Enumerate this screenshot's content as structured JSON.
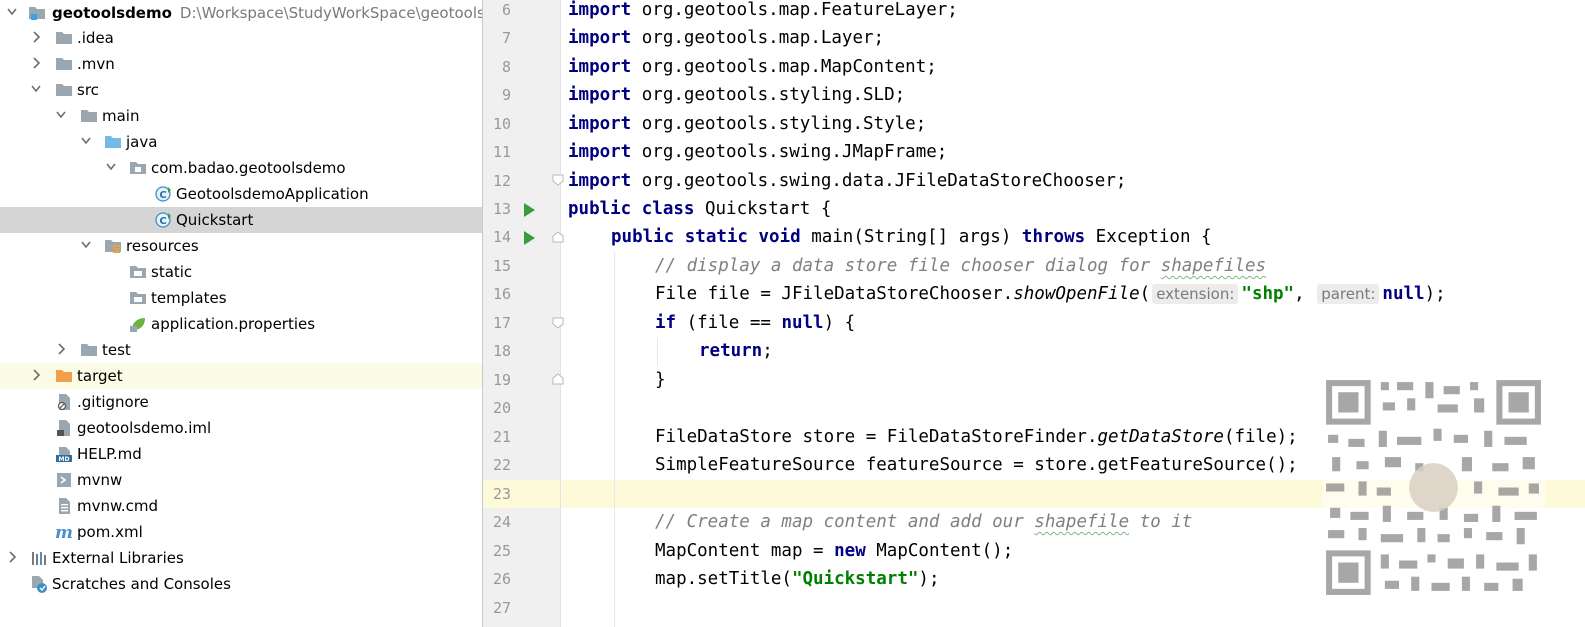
{
  "project": {
    "name": "geotoolsdemo",
    "path": "D:\\Workspace\\StudyWorkSpace\\geotoolsde",
    "items": {
      "idea": ".idea",
      "mvn": ".mvn",
      "src": "src",
      "main": "main",
      "java": "java",
      "package": "com.badao.geotoolsdemo",
      "app_class": "GeotoolsdemoApplication",
      "quickstart": "Quickstart",
      "resources": "resources",
      "static": "static",
      "templates": "templates",
      "app_props": "application.properties",
      "test": "test",
      "target": "target",
      "gitignore": ".gitignore",
      "iml": "geotoolsdemo.iml",
      "help": "HELP.md",
      "mvnw": "mvnw",
      "mvnw_cmd": "mvnw.cmd",
      "pom": "pom.xml",
      "ext_libs": "External Libraries",
      "scratches": "Scratches and Consoles"
    },
    "icon_badges": {
      "md": "MD",
      "maven": "m"
    }
  },
  "editor": {
    "line_numbers": [
      "6",
      "7",
      "8",
      "9",
      "10",
      "11",
      "12",
      "13",
      "14",
      "15",
      "16",
      "17",
      "18",
      "19",
      "20",
      "21",
      "22",
      "23",
      "24",
      "25",
      "26",
      "27"
    ],
    "current_line": "23",
    "tokens": {
      "import": "import",
      "l6": " org.geotools.map.FeatureLayer;",
      "l7": " org.geotools.map.Layer;",
      "l8": " org.geotools.map.MapContent;",
      "l9": " org.geotools.styling.SLD;",
      "l10": " org.geotools.styling.Style;",
      "l11": " org.geotools.swing.JMapFrame;",
      "l12": " org.geotools.swing.data.JFileDataStoreChooser;",
      "l13_kw": "public class",
      "l13_rest": " Quickstart {",
      "l14_kw1": "public static void",
      "l14_mid": " main(String[] args) ",
      "l14_kw2": "throws",
      "l14_rest": " Exception {",
      "l15_cmt_a": "// display a data store file chooser dialog for ",
      "l15_cmt_b": "shapefiles",
      "l16_a": "File file = JFileDataStoreChooser.",
      "l16_method": "showOpenFile",
      "l16_paren": "(",
      "l16_hint1": "extension:",
      "l16_str": "\"shp\"",
      "l16_comma": ",",
      "l16_hint2": "parent:",
      "l16_null": "null",
      "l16_end": ");",
      "l17_if": "if",
      "l17_mid": " (file == ",
      "l17_null": "null",
      "l17_end": ") {",
      "l18_return": "return",
      "l18_end": ";",
      "l19": "}",
      "l21_a": "FileDataStore store = FileDataStoreFinder.",
      "l21_method": "getDataStore",
      "l21_end": "(file);",
      "l22": "SimpleFeatureSource featureSource = store.getFeatureSource();",
      "l24_cmt_a": "// Create a map content and add our ",
      "l24_cmt_b": "shapefile",
      "l24_cmt_c": " to it",
      "l25_a": "MapContent map = ",
      "l25_new": "new",
      "l25_end": " MapContent();",
      "l26_a": "map.setTitle(",
      "l26_str": "\"Quickstart\"",
      "l26_end": ");"
    }
  },
  "colors": {
    "keyword": "#000080",
    "string": "#008000",
    "comment": "#808080",
    "selection": "#d5d5d5",
    "current_line": "#fcfad8",
    "run_gutter": "#3c9c3c"
  }
}
